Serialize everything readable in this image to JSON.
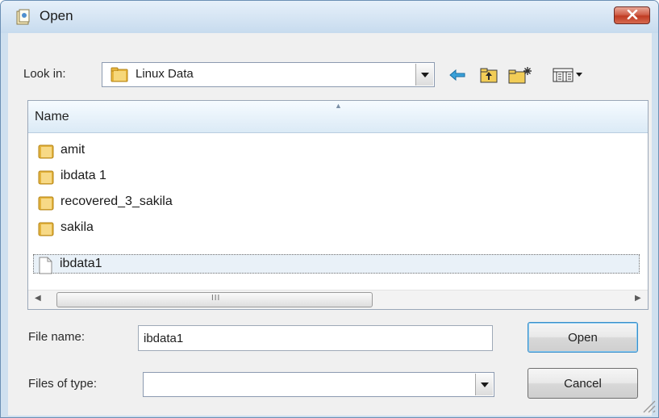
{
  "window": {
    "title": "Open",
    "icon": "open-file-icon"
  },
  "toolbar": {
    "look_in_label": "Look in:",
    "look_in_value": "Linux Data",
    "buttons": [
      "back-arrow-icon",
      "up-folder-icon",
      "new-folder-icon",
      "view-menu-icon"
    ]
  },
  "file_list": {
    "column_header": "Name",
    "items": [
      {
        "name": "amit",
        "type": "folder"
      },
      {
        "name": "ibdata 1",
        "type": "folder"
      },
      {
        "name": "recovered_3_sakila",
        "type": "folder"
      },
      {
        "name": "sakila",
        "type": "folder"
      },
      {
        "name": "ibdata1",
        "type": "file",
        "selected": true
      }
    ],
    "scroll_grip": "III"
  },
  "file_name": {
    "label": "File name:",
    "value": "ibdata1"
  },
  "files_of_type": {
    "label": "Files of type:",
    "value": ""
  },
  "buttons": {
    "open": "Open",
    "cancel": "Cancel"
  },
  "colors": {
    "title_bar": "#c7dbee",
    "close_button": "#c94d34",
    "selection": "#e9f1f8",
    "header": "#dbeaf6"
  }
}
